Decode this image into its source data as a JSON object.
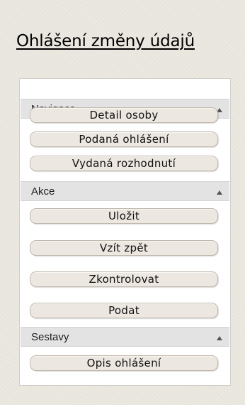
{
  "page": {
    "title": "Ohlášení změny údajů"
  },
  "sections": [
    {
      "label": "Navigace",
      "buttons": [
        "Detail osoby",
        "Podaná ohlášení",
        "Vydaná rozhodnutí"
      ]
    },
    {
      "label": "Akce",
      "buttons": [
        "Uložit",
        "Vzít zpět",
        "Zkontrolovat",
        "Podat"
      ]
    },
    {
      "label": "Sestavy",
      "buttons": [
        "Opis ohlášení"
      ]
    }
  ]
}
